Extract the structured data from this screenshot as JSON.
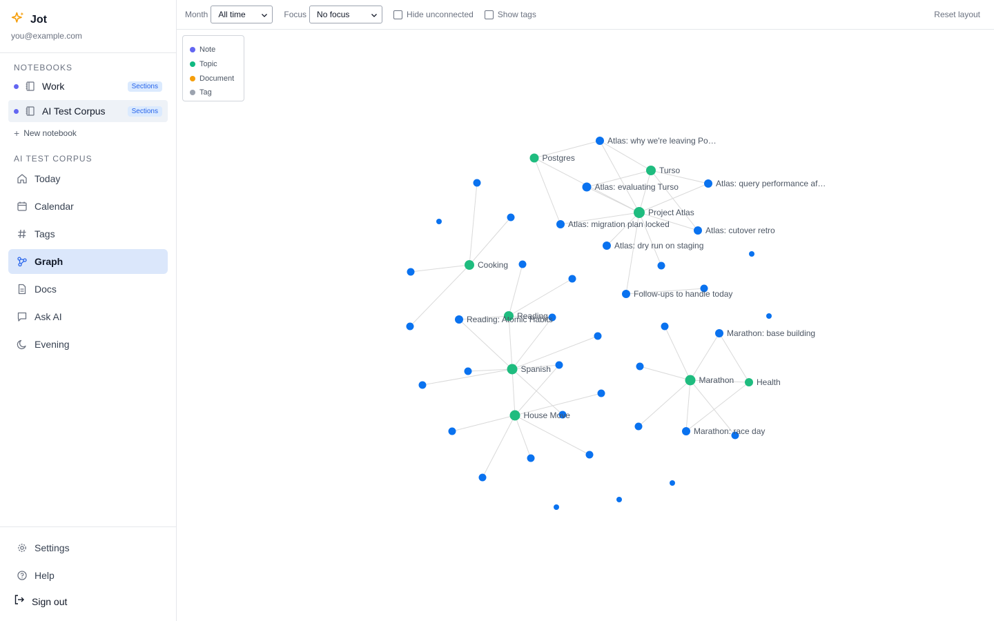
{
  "app": {
    "name": "Jot",
    "email": "you@example.com",
    "logo_icon": "sparkles-icon"
  },
  "notebooks": {
    "heading": "NOTEBOOKS",
    "items": [
      {
        "label": "Work",
        "badge": "Sections",
        "active": false
      },
      {
        "label": "AI Test Corpus",
        "badge": "Sections",
        "active": true
      }
    ],
    "new_label": "New notebook"
  },
  "section": {
    "heading": "AI TEST CORPUS",
    "nav": [
      {
        "label": "Today",
        "icon": "home-icon",
        "active": false
      },
      {
        "label": "Calendar",
        "icon": "calendar-icon",
        "active": false
      },
      {
        "label": "Tags",
        "icon": "hash-icon",
        "active": false
      },
      {
        "label": "Graph",
        "icon": "graph-icon",
        "active": true
      },
      {
        "label": "Docs",
        "icon": "document-icon",
        "active": false
      },
      {
        "label": "Ask AI",
        "icon": "chat-icon",
        "active": false
      },
      {
        "label": "Evening",
        "icon": "moon-icon",
        "active": false
      }
    ]
  },
  "footer": {
    "settings": "Settings",
    "help": "Help",
    "signout": "Sign out"
  },
  "toolbar": {
    "month_label": "Month",
    "month_value": "All time",
    "focus_label": "Focus",
    "focus_value": "No focus",
    "hide_unconnected": "Hide unconnected",
    "show_tags": "Show tags",
    "reset_layout": "Reset layout"
  },
  "legend": [
    {
      "label": "Note",
      "color": "#6366f1"
    },
    {
      "label": "Topic",
      "color": "#10b981"
    },
    {
      "label": "Document",
      "color": "#f59e0b"
    },
    {
      "label": "Tag",
      "color": "#9ca3af"
    }
  ],
  "colors": {
    "note": "#0a72ef",
    "topic": "#1fbc7f",
    "edge": "#d9d9d9",
    "accent": "#2563eb"
  },
  "graph": {
    "node_labels": [
      "Atlas: why we're leaving Po…",
      "Postgres",
      "Turso",
      "Atlas: evaluating Turso",
      "Atlas: query performance af…",
      "Project Atlas",
      "Atlas: migration plan locked",
      "Atlas: cutover retro",
      "Atlas: dry run on staging",
      "Cooking",
      "Follow-ups to handle today",
      "Reading",
      "Reading: Atomic Habits",
      "Marathon: base building",
      "Spanish",
      "Marathon",
      "Health",
      "House Move",
      "Marathon: race day"
    ]
  }
}
